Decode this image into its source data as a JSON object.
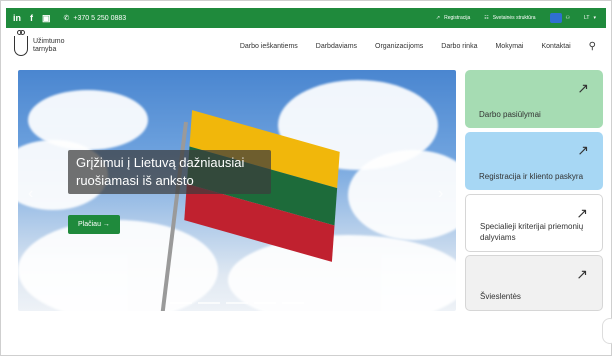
{
  "topbar": {
    "linkedin": "in",
    "facebook": "f",
    "phone": "+370 5 250 0883",
    "registration": "Registracija",
    "structure": "Svetainės struktūra",
    "language": "LT"
  },
  "header": {
    "logo_line1": "Užimtumo",
    "logo_line2": "tarnyba",
    "nav": [
      "Darbo ieškantiems",
      "Darbdaviams",
      "Organizacijoms",
      "Darbo rinka",
      "Mokymai",
      "Kontaktai"
    ]
  },
  "hero": {
    "title": "Grįžimui į Lietuvą dažniausiai ruošiamasi iš anksto",
    "button": "Plačiau →"
  },
  "cards": [
    {
      "label": "Darbo pasiūlymai",
      "color": "#a6dcb3"
    },
    {
      "label": "Registracija ir kliento paskyra",
      "color": "#a7d7f4"
    },
    {
      "label": "Specialieji kriterijai priemonių dalyviams",
      "color": "#ffffff"
    },
    {
      "label": "Švieslentės",
      "color": "#f1f1f1"
    }
  ]
}
